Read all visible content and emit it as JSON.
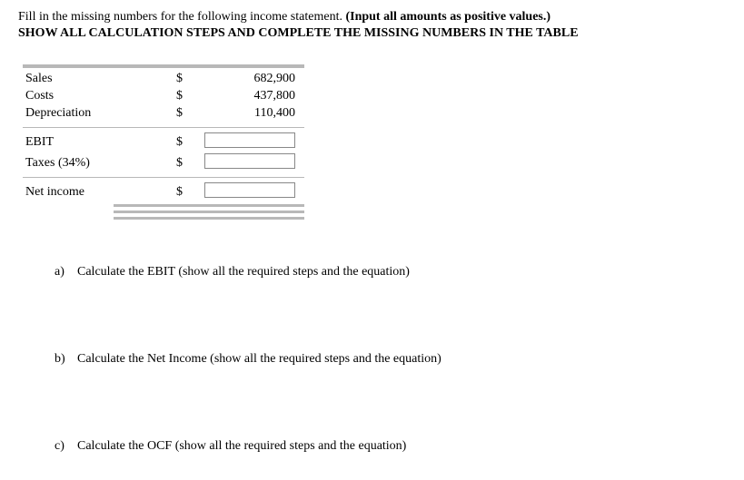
{
  "instructions": {
    "line1": "Fill in the missing numbers for the following income statement. ",
    "line1_bold": "(Input all amounts as positive values.)",
    "line2": "SHOW ALL CALCULATION STEPS AND COMPLETE THE MISSING NUMBERS IN THE TABLE"
  },
  "currency": "$",
  "rows": {
    "sales": {
      "label": "Sales",
      "value": "682,900"
    },
    "costs": {
      "label": "Costs",
      "value": "437,800"
    },
    "depreciation": {
      "label": "Depreciation",
      "value": "110,400"
    },
    "ebit": {
      "label": "EBIT"
    },
    "taxes": {
      "label": "Taxes (34%)"
    },
    "netincome": {
      "label": "Net income"
    }
  },
  "questions": {
    "a": {
      "letter": "a)",
      "text": "Calculate the EBIT (show all the required steps and the equation)"
    },
    "b": {
      "letter": "b)",
      "text": "Calculate the Net Income (show all the required steps and the equation)"
    },
    "c": {
      "letter": "c)",
      "text": "Calculate the OCF (show all the required steps and the equation)"
    }
  }
}
